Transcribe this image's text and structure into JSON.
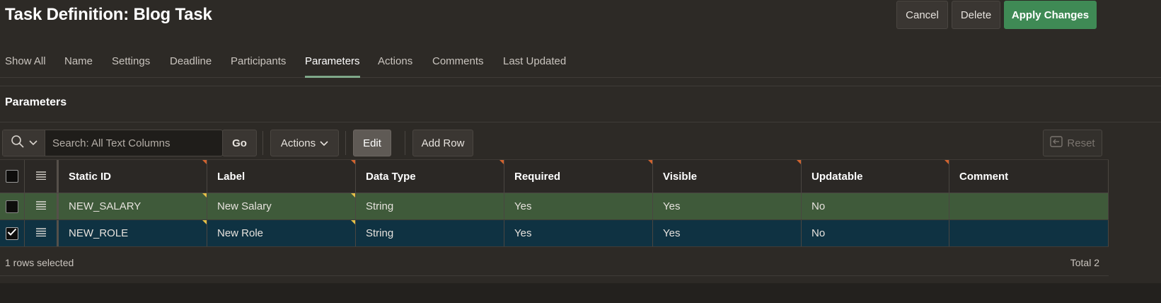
{
  "header": {
    "title": "Task Definition: Blog Task",
    "cancel_label": "Cancel",
    "delete_label": "Delete",
    "apply_label": "Apply Changes"
  },
  "tabs": [
    {
      "label": "Show All"
    },
    {
      "label": "Name"
    },
    {
      "label": "Settings"
    },
    {
      "label": "Deadline"
    },
    {
      "label": "Participants"
    },
    {
      "label": "Parameters",
      "active": true
    },
    {
      "label": "Actions"
    },
    {
      "label": "Comments"
    },
    {
      "label": "Last Updated"
    }
  ],
  "region": {
    "title": "Parameters"
  },
  "toolbar": {
    "search_placeholder": "Search: All Text Columns",
    "go_label": "Go",
    "actions_label": "Actions",
    "edit_label": "Edit",
    "add_row_label": "Add Row",
    "reset_label": "Reset"
  },
  "grid": {
    "columns": [
      "Static ID",
      "Label",
      "Data Type",
      "Required",
      "Visible",
      "Updatable",
      "Comment"
    ],
    "rows": [
      {
        "static_id": "NEW_SALARY",
        "label": "New Salary",
        "data_type": "String",
        "required": "Yes",
        "visible": "Yes",
        "updatable": "No",
        "comment": "",
        "selected": false
      },
      {
        "static_id": "NEW_ROLE",
        "label": "New Role",
        "data_type": "String",
        "required": "Yes",
        "visible": "Yes",
        "updatable": "No",
        "comment": "",
        "selected": true
      }
    ],
    "selection_status": "1 rows selected",
    "total": "Total 2"
  },
  "colors": {
    "primary_button": "#3f8a55",
    "row_edited": "#3f5a3a",
    "row_selected": "#0f3242",
    "change_flag": "#d1632f",
    "modified_flag": "#e4c048",
    "tab_underline": "#7fa889"
  }
}
